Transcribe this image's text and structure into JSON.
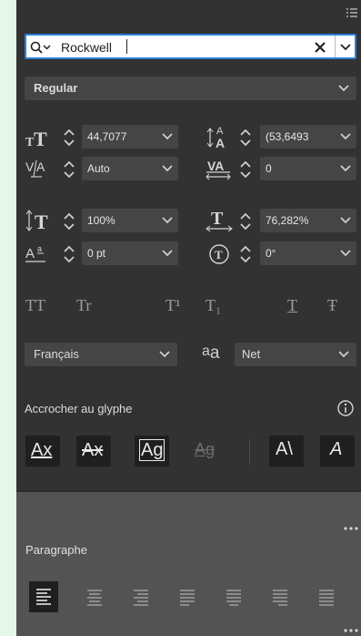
{
  "character": {
    "font_family": "Rockwell",
    "font_style": "Regular",
    "size": "44,7077",
    "leading": "(53,6493",
    "kerning": "Auto",
    "tracking": "0",
    "vertical_scale": "100%",
    "horizontal_scale": "76,282%",
    "baseline_shift": "0 pt",
    "rotation": "0°",
    "language": "Français",
    "antialias": "Net",
    "case_buttons": [
      "TT",
      "Tr",
      "T¹",
      "T₁",
      "T",
      "Ŧ"
    ]
  },
  "snap": {
    "label": "Accrocher au glyphe"
  },
  "paragraph": {
    "title": "Paragraphe"
  }
}
